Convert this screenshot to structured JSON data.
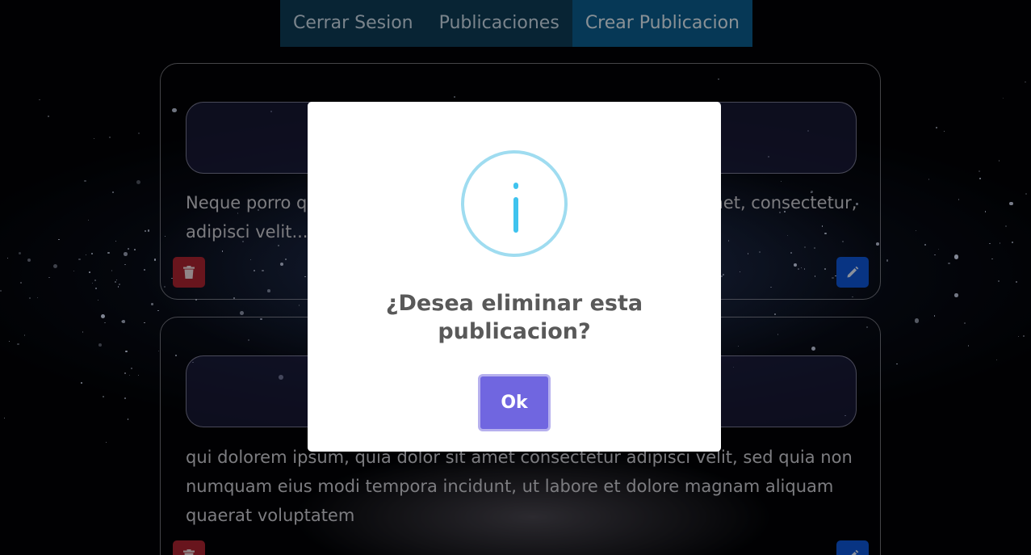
{
  "nav": {
    "items": [
      {
        "label": "Cerrar Sesion",
        "active": false
      },
      {
        "label": "Publicaciones",
        "active": false
      },
      {
        "label": "Crear Publicacion",
        "active": true
      }
    ]
  },
  "posts": [
    {
      "title": "",
      "body": "Neque porro quisquam est qui dolorem ipsum quia dolor sit amet, consectetur, adipisci velit...",
      "delete_icon": "trash-icon",
      "edit_icon": "pencil-icon"
    },
    {
      "title": "",
      "body": "qui dolorem ipsum, quia dolor sit amet consectetur adipisci velit, sed quia non numquam eius modi tempora incidunt, ut labore et dolore magnam aliquam quaerat voluptatem",
      "delete_icon": "trash-icon",
      "edit_icon": "pencil-icon"
    }
  ],
  "dialog": {
    "icon": "info-icon",
    "title": "¿Desea eliminar esta publicacion?",
    "confirm_label": "Ok"
  },
  "colors": {
    "nav_bg": "#0e3a55",
    "nav_active": "#0b5b8b",
    "delete": "#a82330",
    "edit": "#0d55d4",
    "confirm": "#7066e0",
    "info": "#3fc3ee"
  }
}
